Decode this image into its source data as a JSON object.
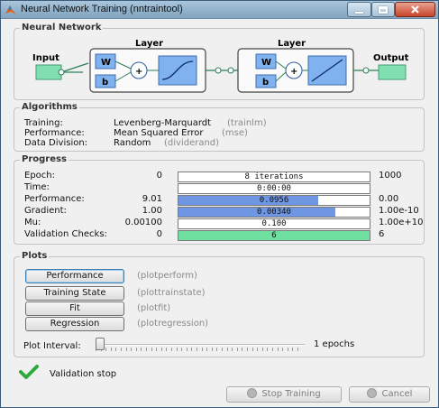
{
  "window": {
    "title": "Neural Network Training (nntraintool)"
  },
  "network": {
    "section_title": "Neural Network",
    "input_label": "Input",
    "output_label": "Output",
    "layer1_label": "Layer",
    "layer2_label": "Layer",
    "w_label": "W",
    "b_label": "b",
    "plus": "+"
  },
  "algorithms": {
    "section_title": "Algorithms",
    "rows": [
      {
        "label": "Training:",
        "value": "Levenberg-Marquardt",
        "fn": "(trainlm)"
      },
      {
        "label": "Performance:",
        "value": "Mean Squared Error",
        "fn": "(mse)"
      },
      {
        "label": "Data Division:",
        "value": "Random",
        "fn": "(dividerand)"
      }
    ]
  },
  "progress": {
    "section_title": "Progress",
    "rows": [
      {
        "label": "Epoch:",
        "start": "0",
        "bar_text": "8 iterations",
        "end": "1000",
        "fill": 0.0,
        "color": "#ffffff"
      },
      {
        "label": "Time:",
        "start": "",
        "bar_text": "0:00:00",
        "end": "",
        "fill": 0.0,
        "color": "#ffffff"
      },
      {
        "label": "Performance:",
        "start": "9.01",
        "bar_text": "0.0956",
        "end": "0.00",
        "fill": 0.73,
        "color": "#6f96e3"
      },
      {
        "label": "Gradient:",
        "start": "1.00",
        "bar_text": "0.00340",
        "end": "1.00e-10",
        "fill": 0.82,
        "color": "#6f96e3"
      },
      {
        "label": "Mu:",
        "start": "0.00100",
        "bar_text": "0.100",
        "end": "1.00e+10",
        "fill": 0.0,
        "color": "#ffffff"
      },
      {
        "label": "Validation Checks:",
        "start": "0",
        "bar_text": "6",
        "end": "6",
        "fill": 1.0,
        "color": "#6fe0a0"
      }
    ]
  },
  "plots": {
    "section_title": "Plots",
    "buttons": [
      {
        "label": "Performance",
        "fn": "(plotperform)"
      },
      {
        "label": "Training State",
        "fn": "(plottrainstate)"
      },
      {
        "label": "Fit",
        "fn": "(plotfit)"
      },
      {
        "label": "Regression",
        "fn": "(plotregression)"
      }
    ],
    "interval_label": "Plot Interval:",
    "interval_value": "1 epochs",
    "interval_level": 0.0
  },
  "status": {
    "text": "Validation stop"
  },
  "footer": {
    "stop_label": "Stop Training",
    "cancel_label": "Cancel"
  },
  "colors": {
    "accent_bar": "#6f96e3",
    "validation_bar": "#6fe0a0",
    "block": "#7fb2ef",
    "io": "#7fdfb0"
  }
}
